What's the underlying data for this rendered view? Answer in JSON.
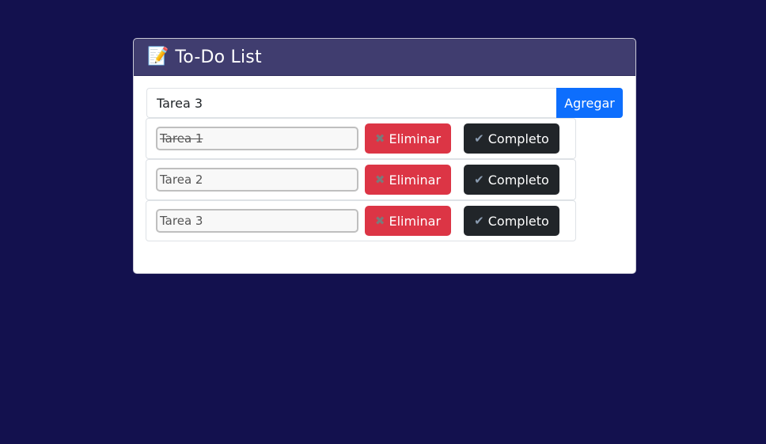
{
  "header": {
    "icon": "memo-icon",
    "icon_glyph": "📝",
    "title": "To-Do List"
  },
  "add_form": {
    "input_value": "Tarea 3",
    "button_label": "Agregar"
  },
  "tasks": [
    {
      "text": "Tarea 1",
      "completed": true,
      "delete_icon": "✖",
      "delete_label": "Eliminar",
      "complete_icon": "✔",
      "complete_label": "Completo"
    },
    {
      "text": "Tarea 2",
      "completed": false,
      "delete_icon": "✖",
      "delete_label": "Eliminar",
      "complete_icon": "✔",
      "complete_label": "Completo"
    },
    {
      "text": "Tarea 3",
      "completed": false,
      "delete_icon": "✖",
      "delete_label": "Eliminar",
      "complete_icon": "✔",
      "complete_label": "Completo"
    }
  ],
  "colors": {
    "background": "#13114e",
    "header": "#403d6f",
    "add_button": "#0d6efd",
    "delete_button": "#dc3545",
    "complete_button": "#212529"
  }
}
